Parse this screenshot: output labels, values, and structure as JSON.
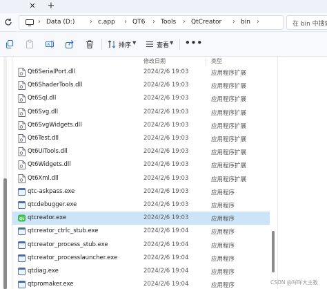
{
  "tabbar": {
    "close_glyph": "✕",
    "new_tab_glyph": "+"
  },
  "address": {
    "breadcrumbs": [
      "Data (D:)",
      "c.app",
      "QT6",
      "Tools",
      "QtCreator",
      "bin"
    ],
    "separator": "›",
    "search_placeholder": "在 bin 中搜索"
  },
  "toolbar": {
    "sort_label": "排序",
    "view_label": "查看",
    "more_glyph": "•••"
  },
  "columns": {
    "date": "修改日期",
    "type": "类型"
  },
  "files": [
    {
      "name": "Qt6SerialPort.dll",
      "date": "2024/2/6 19:03",
      "type": "应用程序扩展",
      "kind": "dll"
    },
    {
      "name": "Qt6ShaderTools.dll",
      "date": "2024/2/6 19:03",
      "type": "应用程序扩展",
      "kind": "dll"
    },
    {
      "name": "Qt6Sql.dll",
      "date": "2024/2/6 19:03",
      "type": "应用程序扩展",
      "kind": "dll"
    },
    {
      "name": "Qt6Svg.dll",
      "date": "2024/2/6 19:03",
      "type": "应用程序扩展",
      "kind": "dll"
    },
    {
      "name": "Qt6SvgWidgets.dll",
      "date": "2024/2/6 19:03",
      "type": "应用程序扩展",
      "kind": "dll"
    },
    {
      "name": "Qt6Test.dll",
      "date": "2024/2/6 19:03",
      "type": "应用程序扩展",
      "kind": "dll"
    },
    {
      "name": "Qt6UiTools.dll",
      "date": "2024/2/6 19:03",
      "type": "应用程序扩展",
      "kind": "dll"
    },
    {
      "name": "Qt6Widgets.dll",
      "date": "2024/2/6 19:03",
      "type": "应用程序扩展",
      "kind": "dll"
    },
    {
      "name": "Qt6Xml.dll",
      "date": "2024/2/6 19:03",
      "type": "应用程序扩展",
      "kind": "dll"
    },
    {
      "name": "qtc-askpass.exe",
      "date": "2024/2/6 19:03",
      "type": "应用程序",
      "kind": "exe"
    },
    {
      "name": "qtcdebugger.exe",
      "date": "2024/2/6 19:03",
      "type": "应用程序",
      "kind": "exe"
    },
    {
      "name": "qtcreator.exe",
      "date": "2024/2/6 19:03",
      "type": "应用程序",
      "kind": "qtexe",
      "selected": true
    },
    {
      "name": "qtcreator_ctrlc_stub.exe",
      "date": "2024/2/6 19:04",
      "type": "应用程序",
      "kind": "exe"
    },
    {
      "name": "qtcreator_process_stub.exe",
      "date": "2024/2/6 19:04",
      "type": "应用程序",
      "kind": "exe"
    },
    {
      "name": "qtcreator_processlauncher.exe",
      "date": "2024/2/6 19:04",
      "type": "应用程序",
      "kind": "exe"
    },
    {
      "name": "qtdiag.exe",
      "date": "2024/2/6 19:04",
      "type": "应用程序",
      "kind": "exe"
    },
    {
      "name": "qtpromaker.exe",
      "date": "2024/2/6 19:04",
      "type": "应用程序",
      "kind": "exe"
    }
  ],
  "watermark": "CSDN @咩咩大主教",
  "colors": {
    "selection": "#cce4f7",
    "accent": "#2f6fd6",
    "qt_green": "#41cd52"
  }
}
